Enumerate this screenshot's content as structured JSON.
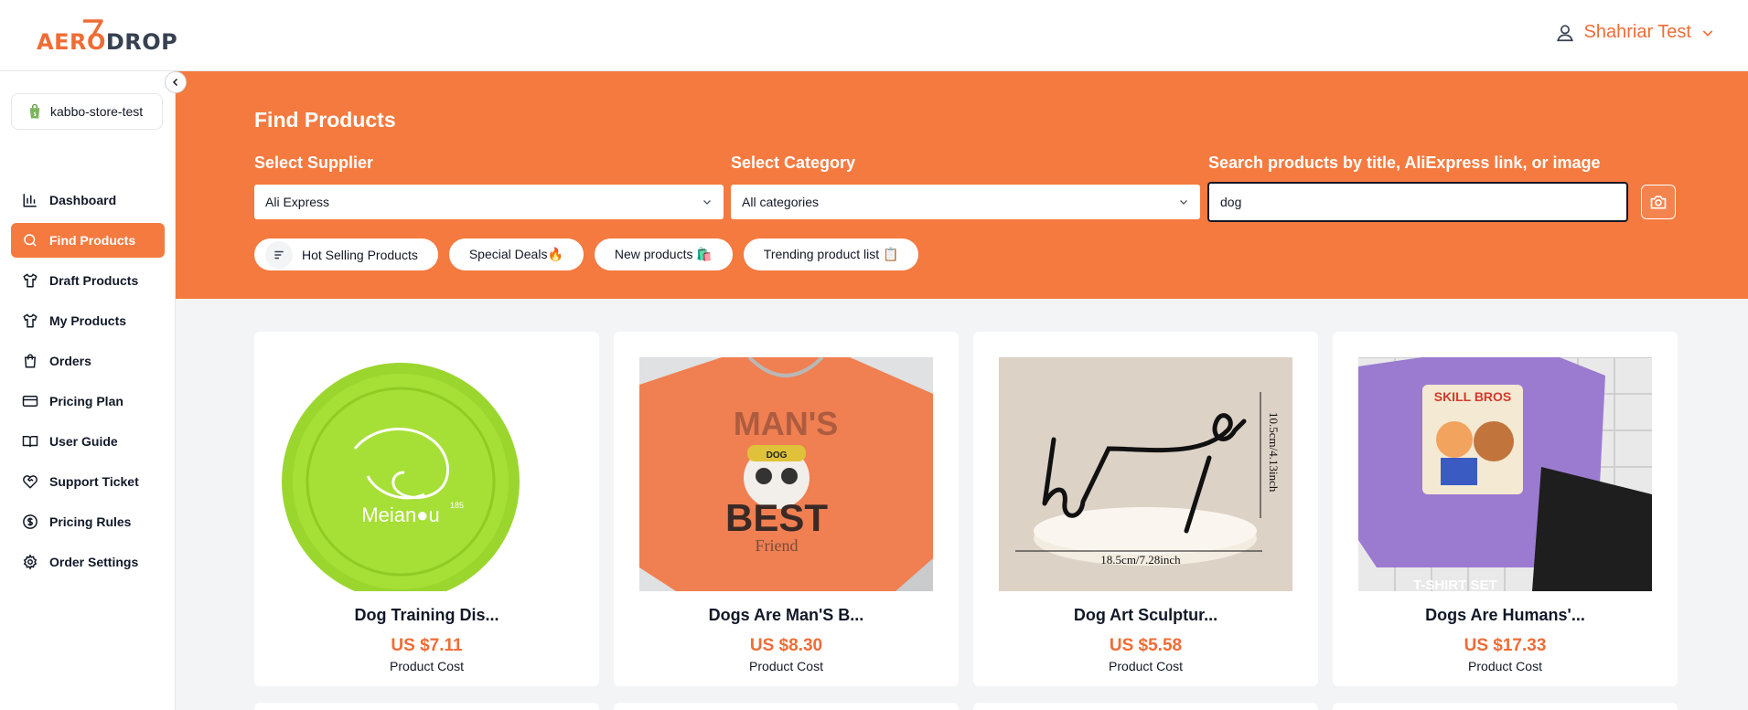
{
  "brand": {
    "logo_text_a": "AERO",
    "logo_text_b": "DROP",
    "accent": "#f47a3f",
    "logo_icon": "seven-mark-icon"
  },
  "header": {
    "user_name": "Shahriar Test",
    "user_icon": "user-icon",
    "chevron": "chevron-down-icon"
  },
  "sidebar": {
    "store_name": "kabbo-store-test",
    "store_icon": "shopify-bag-icon",
    "items": [
      {
        "label": "Dashboard",
        "icon": "bar-chart-icon",
        "active": false
      },
      {
        "label": "Find Products",
        "icon": "search-icon",
        "active": true
      },
      {
        "label": "Draft Products",
        "icon": "shirt-icon",
        "active": false
      },
      {
        "label": "My Products",
        "icon": "shirt-icon",
        "active": false
      },
      {
        "label": "Orders",
        "icon": "shopping-bag-icon",
        "active": false
      },
      {
        "label": "Pricing Plan",
        "icon": "credit-card-icon",
        "active": false
      },
      {
        "label": "User Guide",
        "icon": "book-icon",
        "active": false
      },
      {
        "label": "Support Ticket",
        "icon": "heart-handshake-icon",
        "active": false
      },
      {
        "label": "Pricing Rules",
        "icon": "dollar-circle-icon",
        "active": false
      },
      {
        "label": "Order Settings",
        "icon": "gear-icon",
        "active": false
      }
    ]
  },
  "find": {
    "title": "Find Products",
    "supplier_label": "Select Supplier",
    "supplier_value": "Ali Express",
    "category_label": "Select Category",
    "category_value": "All categories",
    "search_label": "Search products by title, AliExpress link, or image",
    "search_value": "dog",
    "chips": [
      {
        "label": "Hot Selling Products"
      },
      {
        "label": "Special Deals🔥"
      },
      {
        "label": "New products 🛍️"
      },
      {
        "label": "Trending product list 📋"
      }
    ]
  },
  "products": [
    {
      "name": "Dog Training Dis...",
      "price": "US $7.11",
      "cost_label": "Product Cost",
      "image": "green-frisbee"
    },
    {
      "name": "Dogs Are Man'S B...",
      "price": "US $8.30",
      "cost_label": "Product Cost",
      "image": "orange-tshirt"
    },
    {
      "name": "Dog Art Sculptur...",
      "price": "US $5.58",
      "cost_label": "Product Cost",
      "image": "dog-wire-sculpture"
    },
    {
      "name": "Dogs Are Humans'...",
      "price": "US $17.33",
      "cost_label": "Product Cost",
      "image": "purple-tshirt-set"
    }
  ],
  "image_text": {
    "frisbee_brand": "Meian●u",
    "frisbee_size": "185",
    "tshirt_cap": "DOG",
    "tshirt_line1": "MAN'S",
    "tshirt_line2": "BEST",
    "tshirt_line3": "Friend",
    "sculpture_width": "18.5cm/7.28inch",
    "sculpture_height": "10.5cm/4.13inch",
    "set_title": "SKILL BROS",
    "set_footer": "T-SHIRT SET"
  }
}
